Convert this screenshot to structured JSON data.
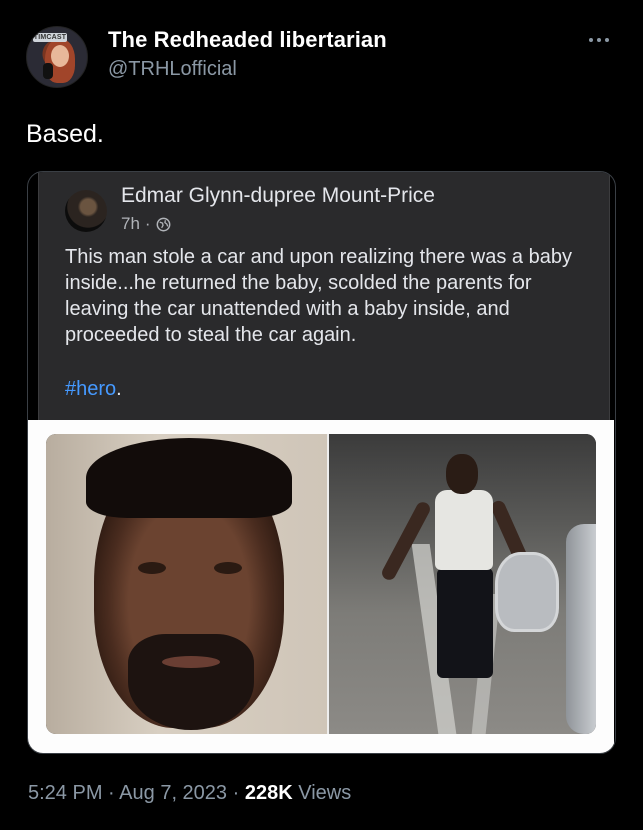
{
  "tweet": {
    "author_name": "The Redheaded libertarian",
    "author_handle": "@TRHLofficial",
    "avatar_badge": "TIMCAST",
    "text": "Based.",
    "time": "5:24 PM",
    "separator": "·",
    "date": "Aug 7, 2023",
    "views_count": "228K",
    "views_label": "Views"
  },
  "quoted_post": {
    "author_name": "Edmar Glynn-dupree Mount-Price",
    "time": "7h",
    "time_separator": "·",
    "body": "This man stole a car and upon realizing there was a baby inside...he returned the baby, scolded the parents for leaving the car unattended with a baby inside, and proceeded to steal the car again.",
    "hashtag": "#hero",
    "hashtag_suffix": "."
  },
  "icons": {
    "more": "more-horizontal-icon",
    "globe": "globe-icon"
  },
  "colors": {
    "background": "#000000",
    "secondary_text": "#8b98a5",
    "hashtag": "#4599ff",
    "fb_card": "#2a2a2c"
  }
}
